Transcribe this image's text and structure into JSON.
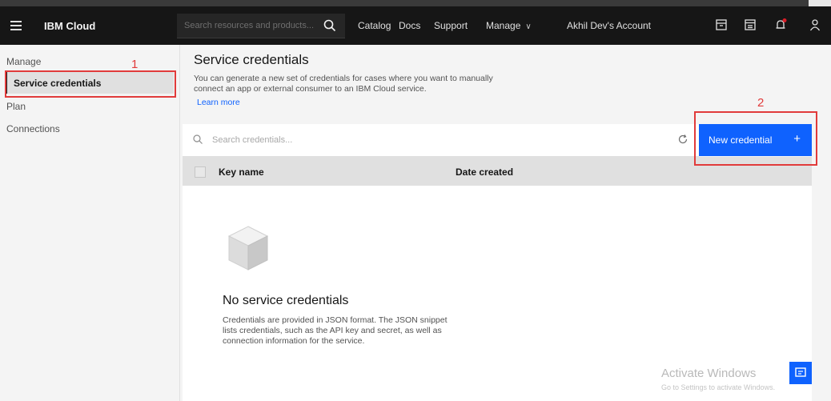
{
  "topbar": {
    "brand": "IBM Cloud",
    "search_placeholder": "Search resources and products...",
    "links": [
      "Catalog",
      "Docs",
      "Support",
      "Manage",
      "Akhil Dev's Account"
    ],
    "icons": [
      "cost-estimator-icon",
      "calendar-icon",
      "notification-icon",
      "user-icon"
    ],
    "notification_color": "#da1e28"
  },
  "sidebar": {
    "items": [
      "Manage",
      "Service credentials",
      "Plan",
      "Connections"
    ],
    "active": "Service credentials"
  },
  "annotations": {
    "mark1": "1",
    "mark2": "2",
    "color": "#e13b3b"
  },
  "main": {
    "title": "Service credentials",
    "description": "You can generate a new set of credentials for cases where you want to manually connect an app or external consumer to an IBM Cloud service.",
    "learn_more": "Learn more",
    "search_placeholder": "Search credentials...",
    "new_button": "New credential",
    "new_button_plus": "+",
    "columns": [
      "Key name",
      "Date created"
    ],
    "empty_title": "No service credentials",
    "empty_description": "Credentials are provided in JSON format. The JSON snippet lists credentials, such as the API key and secret, as well as connection information for the service."
  },
  "watermark": {
    "line1": "Activate Windows",
    "line2": "Go to Settings to activate Windows."
  },
  "colors": {
    "accent": "#0f62fe",
    "topbar": "#161616"
  }
}
